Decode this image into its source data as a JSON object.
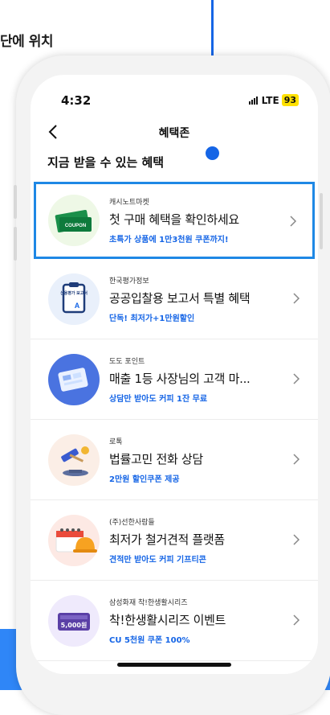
{
  "caption": "단에 위치",
  "colors": {
    "accent": "#1565e6",
    "highlight": "#1e88e5",
    "band": "#2f86f7"
  },
  "status": {
    "time": "4:32",
    "network": "LTE",
    "battery": "93"
  },
  "header": {
    "title": "혜택존",
    "back_icon": "chevron-left-icon"
  },
  "section_title": "지금 받을 수 있는 혜택",
  "items": [
    {
      "brand": "캐시노트마켓",
      "title": "첫 구매 혜택을 확인하세요",
      "subtitle": "초특가 상품에 1만3천원 쿠폰까지!",
      "icon": "coupon-icon",
      "coupon_text": "COUPON",
      "highlighted": true
    },
    {
      "brand": "한국평가정보",
      "title": "공공입찰용 보고서 특별 혜택",
      "subtitle": "단독! 최저가+1만원할인",
      "icon": "report-clipboard-icon",
      "clip_text": "신용평가 보고서",
      "grade": "A"
    },
    {
      "brand": "도도 포인트",
      "title": "매출 1등 사장님의 고객 마...",
      "subtitle": "상담만 받아도 커피 1잔 무료",
      "icon": "tablet-icon"
    },
    {
      "brand": "로톡",
      "title": "법률고민 전화 상담",
      "subtitle": "2만원 할인쿠폰 제공",
      "icon": "gavel-icon"
    },
    {
      "brand": "(주)선한사람들",
      "title": "최저가 철거견적 플랫폼",
      "subtitle": "견적만 받아도 커피 기프티콘",
      "icon": "calendar-helmet-icon"
    },
    {
      "brand": "삼성화재 착!한생활시리즈",
      "title": "착!한생활시리즈 이벤트",
      "subtitle": "CU 5천원 쿠폰 100%",
      "icon": "gift-card-icon",
      "card_text": "5,000원"
    }
  ]
}
